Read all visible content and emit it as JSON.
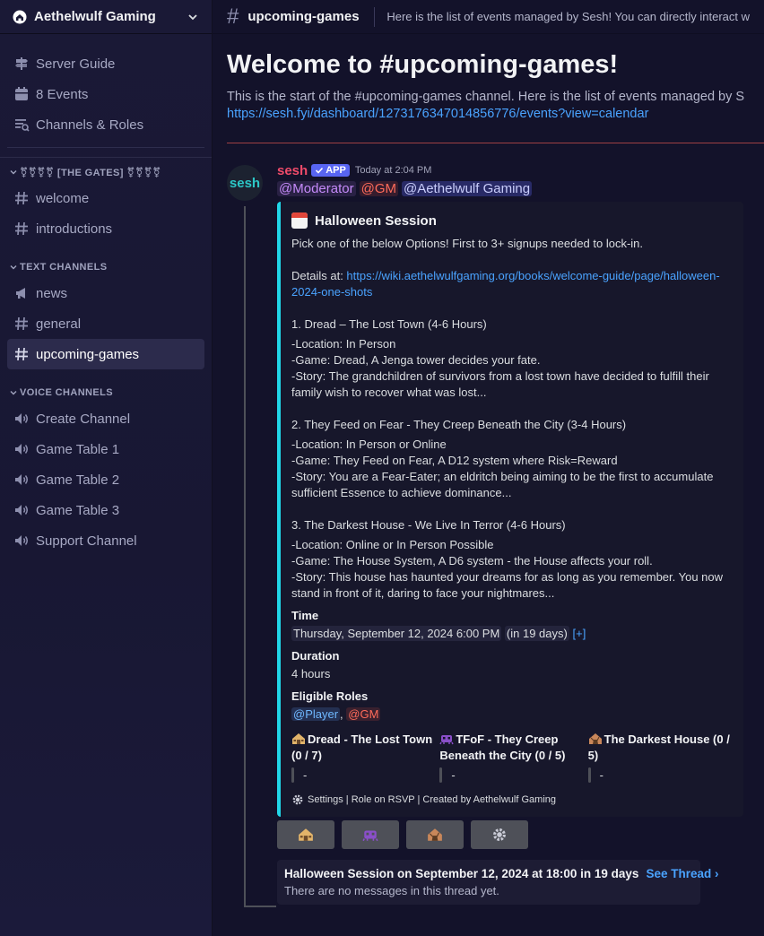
{
  "server": {
    "name": "Aethelwulf Gaming"
  },
  "sidebar": {
    "top": [
      {
        "label": "Server Guide",
        "icon": "signpost-icon"
      },
      {
        "label": "8 Events",
        "icon": "calendar-icon"
      },
      {
        "label": "Channels & Roles",
        "icon": "channels-roles-icon"
      }
    ],
    "categories": [
      {
        "name": "⚧⚧⚧⚧ [THE GATES] ⚧⚧⚧⚧",
        "channels": [
          {
            "label": "welcome",
            "type": "text"
          },
          {
            "label": "introductions",
            "type": "text"
          }
        ]
      },
      {
        "name": "TEXT CHANNELS",
        "channels": [
          {
            "label": "news",
            "type": "announcement"
          },
          {
            "label": "general",
            "type": "text"
          },
          {
            "label": "upcoming-games",
            "type": "text",
            "active": true
          }
        ]
      },
      {
        "name": "VOICE CHANNELS",
        "channels": [
          {
            "label": "Create Channel",
            "type": "voice"
          },
          {
            "label": "Game Table 1",
            "type": "voice"
          },
          {
            "label": "Game Table 2",
            "type": "voice"
          },
          {
            "label": "Game Table 3",
            "type": "voice"
          },
          {
            "label": "Support Channel",
            "type": "voice"
          }
        ]
      }
    ]
  },
  "topbar": {
    "channel": "upcoming-games",
    "topic": "Here is the list of events managed by Sesh! You can directly interact w"
  },
  "welcome": {
    "title": "Welcome to #upcoming-games!",
    "text": "This is the start of the #upcoming-games channel. Here is the list of events managed by S",
    "link": "https://sesh.fyi/dashboard/1273176347014856776/events?view=calendar"
  },
  "message": {
    "avatar_text": "sesh",
    "author": "sesh",
    "badge": "APP",
    "time": "Today at 2:04 PM",
    "mentions": [
      "@Moderator",
      "@GM",
      "@Aethelwulf Gaming"
    ],
    "embed": {
      "title": "Halloween Session",
      "intro": "Pick one of the below Options! First to 3+ signups needed to lock-in.",
      "details_label": "Details at: ",
      "details_link": "https://wiki.aethelwulfgaming.org/books/welcome-guide/page/halloween-2024-one-shots",
      "options": [
        {
          "heading": "1. Dread  – The Lost Town (4-6 Hours)",
          "location": "-Location: In Person",
          "game": "-Game: Dread, A Jenga tower decides your fate.",
          "story": "-Story: The grandchildren of survivors from a lost town have decided to fulfill their family wish to recover what was lost..."
        },
        {
          "heading": "2. They Feed on Fear - They Creep Beneath the City (3-4 Hours)",
          "location": "-Location: In Person or Online",
          "game": "-Game: They Feed on Fear, A D12 system where Risk=Reward",
          "story": "-Story: You are a Fear-Eater; an eldritch being aiming to be the first to accumulate sufficient Essence to achieve dominance..."
        },
        {
          "heading": "3. The Darkest House - We Live In Terror (4-6 Hours)",
          "location": "-Location: Online or In Person Possible",
          "game": "-Game: The House System, A D6 system - the House affects your roll.",
          "story": "-Story: This house has haunted your dreams for as long as you remember. You now stand in front of it, daring to face your nightmares..."
        }
      ],
      "time_label": "Time",
      "time_value": "Thursday, September 12, 2024 6:00 PM",
      "time_relative": "in 19 days",
      "time_plus": "[+]",
      "duration_label": "Duration",
      "duration_value": "4 hours",
      "roles_label": "Eligible Roles",
      "role_player": "@Player",
      "role_sep": ", ",
      "role_gm": "@GM",
      "rsvp": [
        {
          "name": "Dread - The Lost Town (0 / 7)",
          "value": "-"
        },
        {
          "name": "TFoF - They Creep Beneath the City (0 / 5)",
          "value": "-"
        },
        {
          "name": "The Darkest House (0 / 5)",
          "value": "-"
        }
      ],
      "footer": "Settings | Role on RSVP | Created by Aethelwulf Gaming"
    },
    "thread": {
      "title": "Halloween Session on September 12, 2024 at 18:00 in 19 days",
      "see": "See Thread ›",
      "sub": "There are no messages in this thread yet."
    }
  }
}
